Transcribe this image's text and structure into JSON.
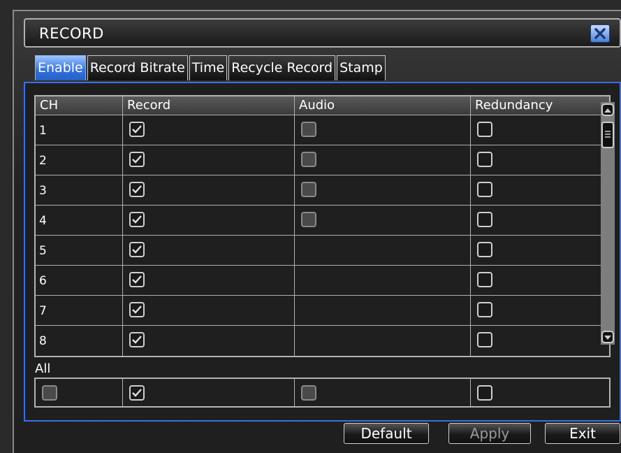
{
  "window": {
    "title": "RECORD"
  },
  "tabs": [
    {
      "label": "Enable",
      "active": true
    },
    {
      "label": "Record Bitrate",
      "active": false
    },
    {
      "label": "Time",
      "active": false
    },
    {
      "label": "Recycle Record",
      "active": false
    },
    {
      "label": "Stamp",
      "active": false
    }
  ],
  "table": {
    "headers": [
      "CH",
      "Record",
      "Audio",
      "Redundancy"
    ],
    "rows": [
      {
        "ch": "1",
        "record": true,
        "audio": "unchecked",
        "redundancy": false
      },
      {
        "ch": "2",
        "record": true,
        "audio": "unchecked",
        "redundancy": false
      },
      {
        "ch": "3",
        "record": true,
        "audio": "unchecked",
        "redundancy": false
      },
      {
        "ch": "4",
        "record": true,
        "audio": "unchecked",
        "redundancy": false
      },
      {
        "ch": "5",
        "record": true,
        "audio": "none",
        "redundancy": false
      },
      {
        "ch": "6",
        "record": true,
        "audio": "none",
        "redundancy": false
      },
      {
        "ch": "7",
        "record": true,
        "audio": "none",
        "redundancy": false
      },
      {
        "ch": "8",
        "record": true,
        "audio": "none",
        "redundancy": false
      }
    ]
  },
  "all": {
    "label": "All",
    "ch": false,
    "record": true,
    "audio": false,
    "redundancy": false
  },
  "buttons": {
    "default": "Default",
    "apply": "Apply",
    "exit": "Exit"
  },
  "colors": {
    "accent": "#3b6fe6",
    "active_tab": "#2f6fe0",
    "background": "#1f1f1f"
  }
}
